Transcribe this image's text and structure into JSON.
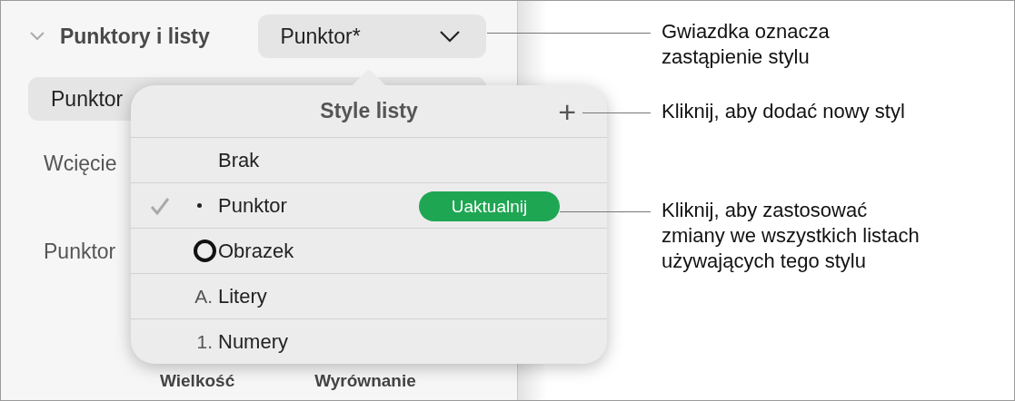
{
  "sidebar": {
    "section_title": "Punktory i listy",
    "expanded": true,
    "style_dropdown": "Punktor*",
    "bullet_type": "Punktor",
    "labels": [
      "Wcięcie",
      "Punktor"
    ],
    "column_headers": [
      "Wielkość",
      "Wyrównanie"
    ]
  },
  "popover": {
    "title": "Style listy",
    "add_button": "+",
    "items": [
      {
        "kind": "none",
        "label": "Brak",
        "selected": false
      },
      {
        "kind": "bullet",
        "label": "Punktor",
        "selected": true,
        "update_button": "Uaktualnij"
      },
      {
        "kind": "image",
        "label": "Obrazek",
        "selected": false
      },
      {
        "kind": "letter",
        "prefix": "A.",
        "label": "Litery",
        "selected": false
      },
      {
        "kind": "number",
        "prefix": "1.",
        "label": "Numery",
        "selected": false
      }
    ]
  },
  "annotations": [
    "Gwiazdka oznacza\nzastąpienie stylu",
    "Kliknij, aby dodać nowy styl",
    "Kliknij, aby zastosować\nzmiany we wszystkich listach\nużywających tego stylu"
  ]
}
